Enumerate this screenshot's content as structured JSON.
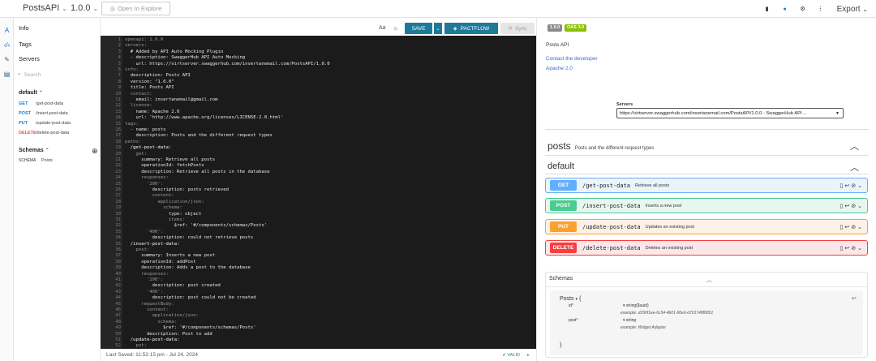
{
  "topbar": {
    "api_name": "PostsAPI",
    "version": "1.0.0",
    "open_in_explore": "Open In Explore",
    "export": "Export"
  },
  "sidebar": {
    "info": "Info",
    "tags": "Tags",
    "servers": "Servers",
    "search_placeholder": "Search",
    "group": "default",
    "endpoints": [
      {
        "method": "GET",
        "path": "/get-post-data",
        "color": "#1f7bc4"
      },
      {
        "method": "POST",
        "path": "/insert-post-data",
        "color": "#1f7bc4"
      },
      {
        "method": "PUT",
        "path": "/update-post-data",
        "color": "#1f7bc4"
      },
      {
        "method": "DELETE",
        "path": "/delete-post-data",
        "color": "#e05a4e"
      }
    ],
    "schemas_label": "Schemas",
    "schema_tag": "SCHEMA",
    "schema_name": "Posts"
  },
  "toolbar": {
    "aa": "Aa",
    "save": "SAVE",
    "pactflow": "PACTFLOW",
    "sync": "Sync"
  },
  "editor": {
    "lines": [
      [
        "openapi: 1.0.0",
        "c"
      ],
      [
        "servers:",
        "c"
      ],
      [
        "  # Added by API Auto Mocking Plugin",
        "s"
      ],
      [
        "  - description: SwaggerHub API Auto Mocking",
        "s"
      ],
      [
        "    url: https://virtserver.swaggerhub.com/insertanemail.com/PostsAPI/1.0.0",
        "s"
      ],
      [
        "info:",
        "c"
      ],
      [
        "  description: Posts API",
        "s"
      ],
      [
        "  version: \"1.0.0\"",
        "s"
      ],
      [
        "  title: Posts API",
        "s"
      ],
      [
        "  contact:",
        "c"
      ],
      [
        "    email: insertanemail@gmail.com",
        "s"
      ],
      [
        "  license:",
        "c"
      ],
      [
        "    name: Apache 2.0",
        "s"
      ],
      [
        "    url: 'http://www.apache.org/licenses/LICENSE-2.0.html'",
        "s"
      ],
      [
        "tags:",
        "c"
      ],
      [
        "  - name: posts",
        "s"
      ],
      [
        "    description: Posts and the different request types",
        "s"
      ],
      [
        "paths:",
        "c"
      ],
      [
        "  /get-post-data:",
        "b"
      ],
      [
        "    get:",
        "c"
      ],
      [
        "      summary: Retrieve all posts",
        "s"
      ],
      [
        "      operationId: fetchPosts",
        "s"
      ],
      [
        "      description: Retrieve all posts in the database",
        "s"
      ],
      [
        "      responses:",
        "c"
      ],
      [
        "        '200':",
        "c"
      ],
      [
        "          description: posts retrieved",
        "s"
      ],
      [
        "          content:",
        "c"
      ],
      [
        "            application/json:",
        "c"
      ],
      [
        "              schema:",
        "c"
      ],
      [
        "                type: object",
        "s"
      ],
      [
        "                items:",
        "c"
      ],
      [
        "                  $ref: '#/components/schemas/Posts'",
        "s"
      ],
      [
        "        '400':",
        "c"
      ],
      [
        "          description: could not retrieve posts",
        "s"
      ],
      [
        "  /insert-post-data:",
        "b"
      ],
      [
        "    post:",
        "c"
      ],
      [
        "      summary: Inserts a new post",
        "s"
      ],
      [
        "      operationId: addPost",
        "s"
      ],
      [
        "      description: Adds a post to the database",
        "s"
      ],
      [
        "      responses:",
        "c"
      ],
      [
        "        '200':",
        "c"
      ],
      [
        "          description: post created",
        "s"
      ],
      [
        "        '400':",
        "c"
      ],
      [
        "          description: post could not be created",
        "s"
      ],
      [
        "      requestBody:",
        "c"
      ],
      [
        "        content:",
        "c"
      ],
      [
        "          application/json:",
        "c"
      ],
      [
        "            schema:",
        "c"
      ],
      [
        "              $ref: '#/components/schemas/Posts'",
        "s"
      ],
      [
        "        description: Post to add",
        "s"
      ],
      [
        "  /update-post-data:",
        "b"
      ],
      [
        "    put:",
        "c"
      ]
    ]
  },
  "status": {
    "last_saved": "Last Saved:  11:52:15 pm  -  Jul 24, 2024",
    "valid": "✔ VALID"
  },
  "preview": {
    "badge_version": "1.0.0",
    "badge_oas": "OAS 3.0",
    "badge_version_color": "#8a8a8a",
    "badge_oas_color": "#89bf04",
    "title": "Posts API",
    "contact_link": "Contact the developer",
    "license_link": "Apache 2.0",
    "servers_label": "Servers",
    "servers_value": "https://virtserver.swaggerhub.com/insertanemail.com/PostsAPI/1.0.0 - SwaggerHub API ...",
    "tag_posts_name": "posts",
    "tag_posts_desc": "Posts and the different request types",
    "tag_default": "default",
    "operations": [
      {
        "method": "GET",
        "path": "/get-post-data",
        "summary": "Retrieve all posts",
        "color": "#61affe",
        "bg": "#ebf3fb"
      },
      {
        "method": "POST",
        "path": "/insert-post-data",
        "summary": "Inserts a new post",
        "color": "#49cc90",
        "bg": "#e8f6f0"
      },
      {
        "method": "PUT",
        "path": "/update-post-data",
        "summary": "Updates an existing post",
        "color": "#fca130",
        "bg": "#fbf1e6"
      },
      {
        "method": "DELETE",
        "path": "/delete-post-data",
        "summary": "Deletes an existing post",
        "color": "#f93e3e",
        "bg": "#fae7e7"
      }
    ],
    "schemas_label": "Schemas",
    "model_name": "Posts",
    "model_open": "{",
    "model_close": "}",
    "field_id": "id*",
    "field_id_type": "string($uuid)",
    "field_id_example": "example: d290f1ee-6c54-4b01-90e6-d701748f0851",
    "field_post": "post*",
    "field_post_type": "string",
    "field_post_example": "example: Widget Adapter"
  }
}
